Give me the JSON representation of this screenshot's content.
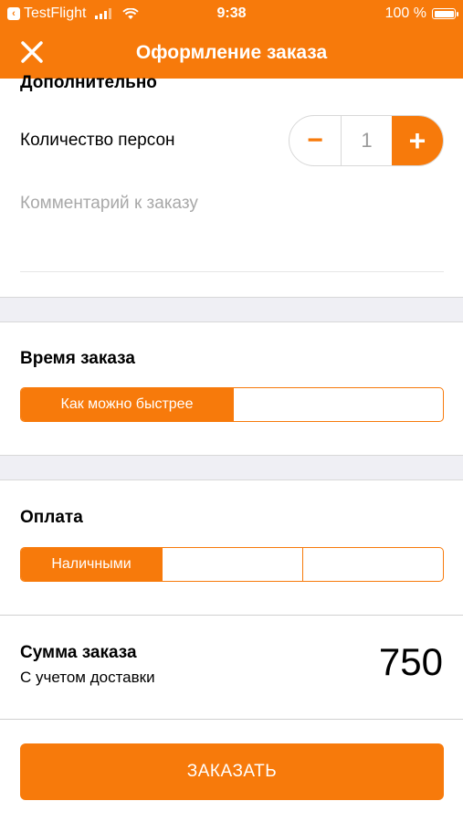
{
  "status_bar": {
    "back_app": "TestFlight",
    "time": "9:38",
    "battery": "100 %"
  },
  "header": {
    "title": "Оформление заказа",
    "close_icon": "close-icon"
  },
  "additional": {
    "section_title": "Дополнительно",
    "persons_label": "Количество персон",
    "stepper": {
      "minus": "−",
      "value": "1",
      "plus": "+"
    },
    "comment_placeholder": "Комментарий к заказу"
  },
  "order_time": {
    "title": "Время заказа",
    "options": [
      "Как можно быстрее",
      ""
    ],
    "selected": 0
  },
  "payment": {
    "title": "Оплата",
    "options": [
      "Наличными",
      "",
      ""
    ],
    "selected": 0
  },
  "summary": {
    "title": "Сумма заказа",
    "subtitle": "С учетом доставки",
    "value": "750"
  },
  "submit": {
    "label": "ЗАКАЗАТЬ"
  },
  "colors": {
    "accent": "#f77a0b",
    "separator": "#efeff4"
  }
}
